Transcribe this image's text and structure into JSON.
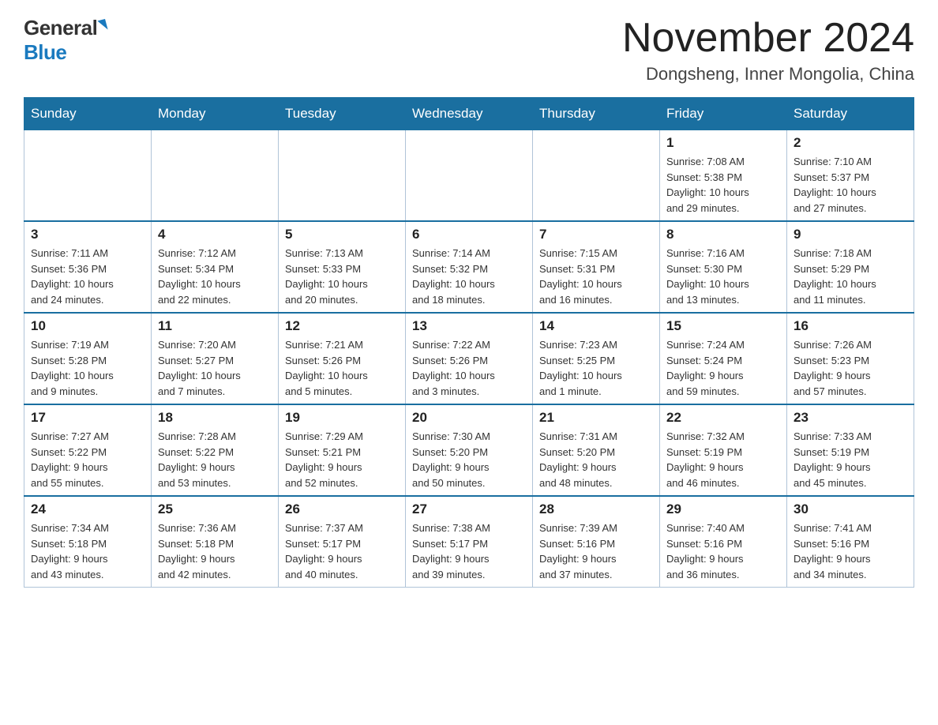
{
  "header": {
    "logo_general": "General",
    "logo_blue": "Blue",
    "month_title": "November 2024",
    "location": "Dongsheng, Inner Mongolia, China"
  },
  "days_of_week": [
    "Sunday",
    "Monday",
    "Tuesday",
    "Wednesday",
    "Thursday",
    "Friday",
    "Saturday"
  ],
  "weeks": [
    [
      {
        "day": "",
        "info": ""
      },
      {
        "day": "",
        "info": ""
      },
      {
        "day": "",
        "info": ""
      },
      {
        "day": "",
        "info": ""
      },
      {
        "day": "",
        "info": ""
      },
      {
        "day": "1",
        "info": "Sunrise: 7:08 AM\nSunset: 5:38 PM\nDaylight: 10 hours\nand 29 minutes."
      },
      {
        "day": "2",
        "info": "Sunrise: 7:10 AM\nSunset: 5:37 PM\nDaylight: 10 hours\nand 27 minutes."
      }
    ],
    [
      {
        "day": "3",
        "info": "Sunrise: 7:11 AM\nSunset: 5:36 PM\nDaylight: 10 hours\nand 24 minutes."
      },
      {
        "day": "4",
        "info": "Sunrise: 7:12 AM\nSunset: 5:34 PM\nDaylight: 10 hours\nand 22 minutes."
      },
      {
        "day": "5",
        "info": "Sunrise: 7:13 AM\nSunset: 5:33 PM\nDaylight: 10 hours\nand 20 minutes."
      },
      {
        "day": "6",
        "info": "Sunrise: 7:14 AM\nSunset: 5:32 PM\nDaylight: 10 hours\nand 18 minutes."
      },
      {
        "day": "7",
        "info": "Sunrise: 7:15 AM\nSunset: 5:31 PM\nDaylight: 10 hours\nand 16 minutes."
      },
      {
        "day": "8",
        "info": "Sunrise: 7:16 AM\nSunset: 5:30 PM\nDaylight: 10 hours\nand 13 minutes."
      },
      {
        "day": "9",
        "info": "Sunrise: 7:18 AM\nSunset: 5:29 PM\nDaylight: 10 hours\nand 11 minutes."
      }
    ],
    [
      {
        "day": "10",
        "info": "Sunrise: 7:19 AM\nSunset: 5:28 PM\nDaylight: 10 hours\nand 9 minutes."
      },
      {
        "day": "11",
        "info": "Sunrise: 7:20 AM\nSunset: 5:27 PM\nDaylight: 10 hours\nand 7 minutes."
      },
      {
        "day": "12",
        "info": "Sunrise: 7:21 AM\nSunset: 5:26 PM\nDaylight: 10 hours\nand 5 minutes."
      },
      {
        "day": "13",
        "info": "Sunrise: 7:22 AM\nSunset: 5:26 PM\nDaylight: 10 hours\nand 3 minutes."
      },
      {
        "day": "14",
        "info": "Sunrise: 7:23 AM\nSunset: 5:25 PM\nDaylight: 10 hours\nand 1 minute."
      },
      {
        "day": "15",
        "info": "Sunrise: 7:24 AM\nSunset: 5:24 PM\nDaylight: 9 hours\nand 59 minutes."
      },
      {
        "day": "16",
        "info": "Sunrise: 7:26 AM\nSunset: 5:23 PM\nDaylight: 9 hours\nand 57 minutes."
      }
    ],
    [
      {
        "day": "17",
        "info": "Sunrise: 7:27 AM\nSunset: 5:22 PM\nDaylight: 9 hours\nand 55 minutes."
      },
      {
        "day": "18",
        "info": "Sunrise: 7:28 AM\nSunset: 5:22 PM\nDaylight: 9 hours\nand 53 minutes."
      },
      {
        "day": "19",
        "info": "Sunrise: 7:29 AM\nSunset: 5:21 PM\nDaylight: 9 hours\nand 52 minutes."
      },
      {
        "day": "20",
        "info": "Sunrise: 7:30 AM\nSunset: 5:20 PM\nDaylight: 9 hours\nand 50 minutes."
      },
      {
        "day": "21",
        "info": "Sunrise: 7:31 AM\nSunset: 5:20 PM\nDaylight: 9 hours\nand 48 minutes."
      },
      {
        "day": "22",
        "info": "Sunrise: 7:32 AM\nSunset: 5:19 PM\nDaylight: 9 hours\nand 46 minutes."
      },
      {
        "day": "23",
        "info": "Sunrise: 7:33 AM\nSunset: 5:19 PM\nDaylight: 9 hours\nand 45 minutes."
      }
    ],
    [
      {
        "day": "24",
        "info": "Sunrise: 7:34 AM\nSunset: 5:18 PM\nDaylight: 9 hours\nand 43 minutes."
      },
      {
        "day": "25",
        "info": "Sunrise: 7:36 AM\nSunset: 5:18 PM\nDaylight: 9 hours\nand 42 minutes."
      },
      {
        "day": "26",
        "info": "Sunrise: 7:37 AM\nSunset: 5:17 PM\nDaylight: 9 hours\nand 40 minutes."
      },
      {
        "day": "27",
        "info": "Sunrise: 7:38 AM\nSunset: 5:17 PM\nDaylight: 9 hours\nand 39 minutes."
      },
      {
        "day": "28",
        "info": "Sunrise: 7:39 AM\nSunset: 5:16 PM\nDaylight: 9 hours\nand 37 minutes."
      },
      {
        "day": "29",
        "info": "Sunrise: 7:40 AM\nSunset: 5:16 PM\nDaylight: 9 hours\nand 36 minutes."
      },
      {
        "day": "30",
        "info": "Sunrise: 7:41 AM\nSunset: 5:16 PM\nDaylight: 9 hours\nand 34 minutes."
      }
    ]
  ]
}
